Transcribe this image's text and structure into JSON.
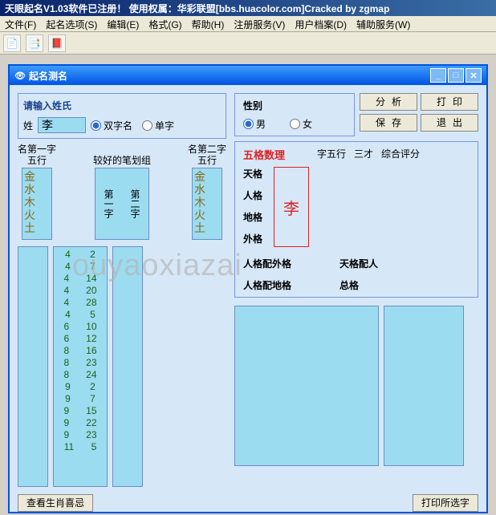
{
  "titlebar": "天眼起名V1.03软件已注册！ 使用权属：华彩联盟[bbs.huacolor.com]Cracked by zgmap",
  "menus": [
    "文件(F)",
    "起名选项(S)",
    "编辑(E)",
    "格式(G)",
    "帮助(H)",
    "注册服务(V)",
    "用户档案(D)",
    "辅助服务(W)"
  ],
  "inner_title": "起名测名",
  "surname": {
    "prompt": "请输入姓氏",
    "label": "姓",
    "value": "李",
    "opt_double": "双字名",
    "opt_single": "单字"
  },
  "col1": {
    "label_a": "名第一字",
    "label_b": "五行"
  },
  "col_mid": {
    "label": "较好的笔划组",
    "h1": "第一字",
    "h2": "第二字"
  },
  "col2": {
    "label_a": "名第二字",
    "label_b": "五行"
  },
  "wuxing": [
    "金",
    "水",
    "木",
    "火",
    "土"
  ],
  "strokes": [
    [
      "4",
      "2"
    ],
    [
      "4",
      "7"
    ],
    [
      "4",
      "14"
    ],
    [
      "4",
      "20"
    ],
    [
      "4",
      "28"
    ],
    [
      "4",
      "5"
    ],
    [
      "6",
      "10"
    ],
    [
      "6",
      "12"
    ],
    [
      "8",
      "16"
    ],
    [
      "8",
      "23"
    ],
    [
      "8",
      "24"
    ],
    [
      "9",
      "2"
    ],
    [
      "9",
      "7"
    ],
    [
      "9",
      "15"
    ],
    [
      "9",
      "22"
    ],
    [
      "9",
      "23"
    ],
    [
      "11",
      "5"
    ]
  ],
  "gender": {
    "label": "性别",
    "m": "男",
    "f": "女"
  },
  "buttons": {
    "analyze": "分析",
    "print": "打印",
    "save": "保存",
    "exit": "退出"
  },
  "wuge": {
    "title": "五格数理",
    "tg": "天格",
    "rg": "人格",
    "dg": "地格",
    "wg": "外格",
    "display_char": "李",
    "tab1": "字五行",
    "tab2": "三才",
    "tab3": "综合评分",
    "p1": "人格配外格",
    "p2": "天格配人",
    "p3": "人格配地格",
    "p4": "总格"
  },
  "bottom": {
    "zodiac": "查看生肖喜忌",
    "print_sel": "打印所选字"
  },
  "watermark": "ouyaoxiazai"
}
